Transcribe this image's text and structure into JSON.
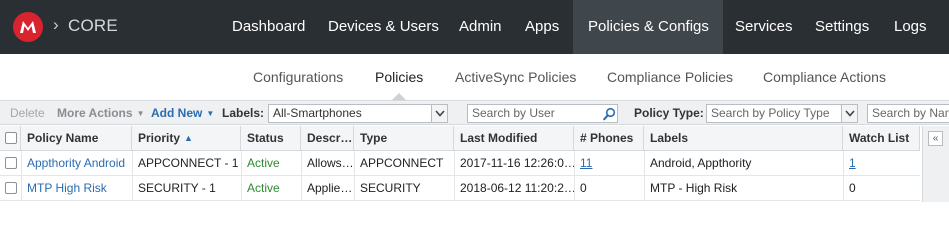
{
  "app": {
    "name": "CORE",
    "crumb_separator": "›",
    "logo_color": "#d9232e"
  },
  "topnav": {
    "items": [
      {
        "label": "Dashboard"
      },
      {
        "label": "Devices & Users"
      },
      {
        "label": "Admin"
      },
      {
        "label": "Apps"
      },
      {
        "label": "Policies & Configs",
        "active": true
      },
      {
        "label": "Services"
      },
      {
        "label": "Settings"
      },
      {
        "label": "Logs"
      }
    ]
  },
  "subnav": {
    "items": [
      {
        "label": "Configurations"
      },
      {
        "label": "Policies",
        "active": true
      },
      {
        "label": "ActiveSync Policies"
      },
      {
        "label": "Compliance Policies"
      },
      {
        "label": "Compliance Actions"
      }
    ]
  },
  "toolbar": {
    "delete_label": "Delete",
    "more_actions_label": "More Actions",
    "add_new_label": "Add New",
    "labels_label": "Labels:",
    "labels_value": "All-Smartphones",
    "search_user_placeholder": "Search by User",
    "policy_type_label": "Policy Type:",
    "policy_type_value": "Search by Policy Type",
    "search_name_placeholder": "Search by Nam"
  },
  "grid": {
    "columns": {
      "policy_name": "Policy Name",
      "priority": "Priority",
      "status": "Status",
      "description": "Descr…",
      "type": "Type",
      "last_modified": "Last Modified",
      "phones": "# Phones",
      "labels": "Labels",
      "watch_list": "Watch List"
    },
    "rows": [
      {
        "policy_name": "Appthority Android",
        "priority": "APPCONNECT - 1",
        "status": "Active",
        "description": "Allows…",
        "type": "APPCONNECT",
        "last_modified": "2017-11-16 12:26:0…",
        "phones": "11",
        "labels": "Android, Appthority",
        "watch_list": "1"
      },
      {
        "policy_name": "MTP High Risk",
        "priority": "SECURITY - 1",
        "status": "Active",
        "description": "Applie…",
        "type": "SECURITY",
        "last_modified": "2018-06-12 11:20:2…",
        "phones": "0",
        "labels": "MTP - High Risk",
        "watch_list": "0"
      }
    ]
  },
  "side_panel": {
    "collapse_label": "«"
  },
  "colors": {
    "topbar": "#2a2f34",
    "topbar_active": "#3f464c",
    "link": "#2b6cb0",
    "active_status": "#2e8b2e"
  }
}
